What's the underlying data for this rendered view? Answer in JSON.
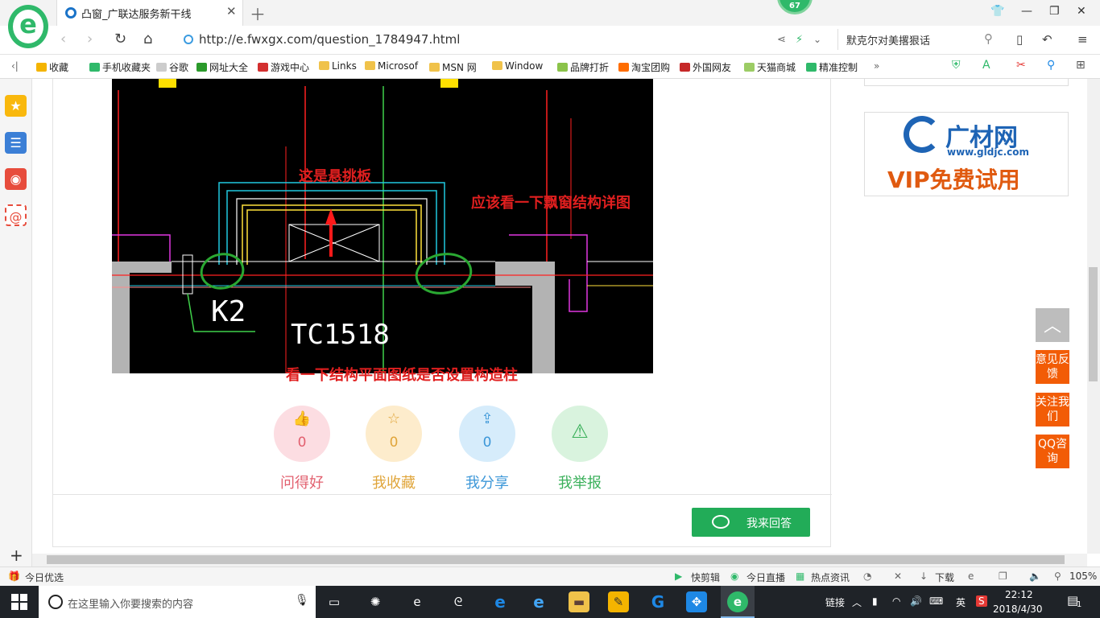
{
  "browser": {
    "tab_title": "凸窗_广联达服务新干线",
    "badge_count": "67",
    "url": "http://e.fwxgx.com/question_1784947.html",
    "search_text": "默克尔对美撂狠话"
  },
  "bookmarks": [
    {
      "label": "收藏",
      "color": "#f4b400"
    },
    {
      "label": "手机收藏夹",
      "color": "#2fb96a"
    },
    {
      "label": "谷歌",
      "color": "#cccccc"
    },
    {
      "label": "网址大全",
      "color": "#2b9a2b"
    },
    {
      "label": "游戏中心",
      "color": "#d32f2f"
    },
    {
      "label": "Links",
      "color": "#f0c24a"
    },
    {
      "label": "Microsof",
      "color": "#f0c24a"
    },
    {
      "label": "MSN 网",
      "color": "#f0c24a"
    },
    {
      "label": "Window",
      "color": "#f0c24a"
    },
    {
      "label": "品牌打折",
      "color": "#8bc34a"
    },
    {
      "label": "淘宝团购",
      "color": "#ff6d00"
    },
    {
      "label": "外国网友",
      "color": "#c62828"
    },
    {
      "label": "天猫商城",
      "color": "#9ccc65"
    },
    {
      "label": "精准控制",
      "color": "#2fb96a"
    }
  ],
  "image": {
    "annotation_top": "这是悬挑板",
    "annotation_right": "应该看一下飘窗结构详图",
    "annotation_bottom": "看一下结构平面图纸是否设置构造柱",
    "cad_label_k2": "K2",
    "cad_label_tc": "TC1518"
  },
  "actions": [
    {
      "label": "问得好",
      "count": "0",
      "icon": "thumbs-up-icon",
      "bg": "#fcdde2",
      "fg": "#e2606f"
    },
    {
      "label": "我收藏",
      "count": "0",
      "icon": "star-icon",
      "bg": "#fdeccc",
      "fg": "#e0a53a"
    },
    {
      "label": "我分享",
      "count": "0",
      "icon": "share-icon",
      "bg": "#d6ecfb",
      "fg": "#3c97d8"
    },
    {
      "label": "我举报",
      "count": "",
      "icon": "warning-icon",
      "bg": "#d9f3de",
      "fg": "#3ab05a"
    }
  ],
  "answer_button": "我来回答",
  "ad": {
    "brand": "广材网",
    "site": "www.gldjc.com",
    "promo": "VIP免费试用"
  },
  "float": {
    "feedback": "意见反馈",
    "follow": "关注我们",
    "qq": "QQ咨询"
  },
  "statusbar": {
    "left": "今日优选",
    "items": [
      "快剪辑",
      "今日直播",
      "热点资讯",
      "下载"
    ],
    "zoom": "105%"
  },
  "taskbar": {
    "search_placeholder": "在这里输入你要搜索的内容",
    "tray_link": "链接",
    "ime": "英",
    "time": "22:12",
    "date": "2018/4/30",
    "notif": "1"
  }
}
